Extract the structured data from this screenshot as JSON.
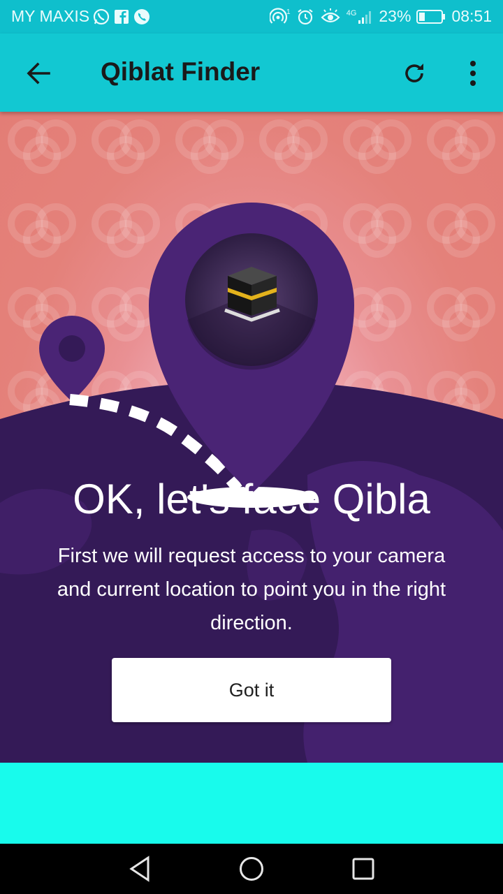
{
  "status_bar": {
    "carrier": "MY MAXIS",
    "network": "4G",
    "battery_percent": "23%",
    "time": "08:51"
  },
  "app_bar": {
    "title": "Qiblat Finder",
    "back_icon": "arrow-back-icon",
    "refresh_icon": "refresh-icon",
    "more_icon": "more-vert-icon"
  },
  "onboarding": {
    "headline": "OK, let's face Qibla",
    "description": "First we will request access to your camera and current location to point you in the right direction.",
    "button_label": "Got it"
  },
  "nav_bar": {
    "back_icon": "nav-back-icon",
    "home_icon": "nav-home-icon",
    "recents_icon": "nav-recents-icon"
  },
  "colors": {
    "status_bar": "#0fbfcc",
    "app_bar": "#12c8d2",
    "hill_purple": "#341a57",
    "pin_purple": "#4a2475",
    "footer_band": "#18fbec",
    "button_bg": "#ffffff"
  }
}
